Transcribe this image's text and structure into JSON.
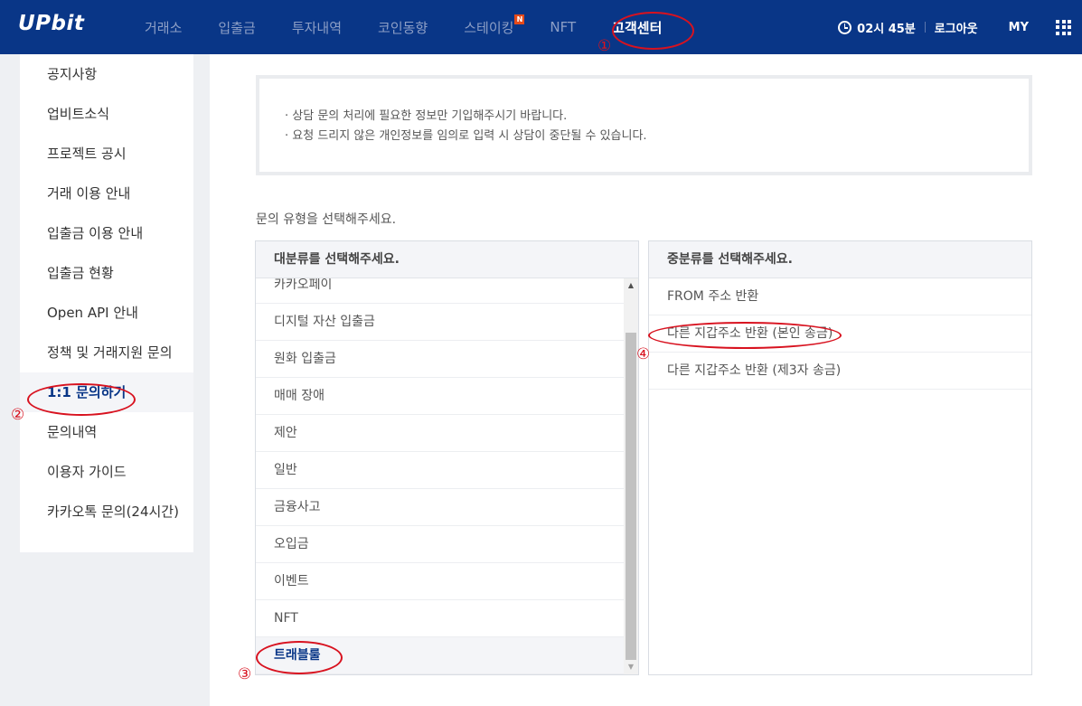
{
  "header": {
    "logo": "UPbit",
    "nav": [
      {
        "label": "거래소",
        "active": false
      },
      {
        "label": "입출금",
        "active": false
      },
      {
        "label": "투자내역",
        "active": false
      },
      {
        "label": "코인동향",
        "active": false
      },
      {
        "label": "스테이킹",
        "active": false,
        "badge": "N"
      },
      {
        "label": "NFT",
        "active": false
      },
      {
        "label": "고객센터",
        "active": true
      }
    ],
    "time": "02시 45분",
    "logout": "로그아웃",
    "my": "MY"
  },
  "sidebar": {
    "items": [
      {
        "label": "공지사항",
        "active": false
      },
      {
        "label": "업비트소식",
        "active": false
      },
      {
        "label": "프로젝트 공시",
        "active": false
      },
      {
        "label": "거래 이용 안내",
        "active": false
      },
      {
        "label": "입출금 이용 안내",
        "active": false
      },
      {
        "label": "입출금 현황",
        "active": false
      },
      {
        "label": "Open API 안내",
        "active": false
      },
      {
        "label": "정책 및 거래지원 문의",
        "active": false
      },
      {
        "label": "1:1 문의하기",
        "active": true
      },
      {
        "label": "문의내역",
        "active": false
      },
      {
        "label": "이용자 가이드",
        "active": false
      },
      {
        "label": "카카오톡 문의(24시간)",
        "active": false
      }
    ]
  },
  "notice": {
    "lines": [
      "· 상담 문의 처리에 필요한 정보만 기입해주시기 바랍니다.",
      "· 요청 드리지 않은 개인정보를 임의로 입력 시 상담이 중단될 수 있습니다."
    ]
  },
  "prompt": "문의 유형을 선택해주세요.",
  "major": {
    "header": "대분류를 선택해주세요.",
    "items": [
      {
        "label": "카카오페이",
        "selected": false
      },
      {
        "label": "디지털 자산 입출금",
        "selected": false
      },
      {
        "label": "원화 입출금",
        "selected": false
      },
      {
        "label": "매매 장애",
        "selected": false
      },
      {
        "label": "제안",
        "selected": false
      },
      {
        "label": "일반",
        "selected": false
      },
      {
        "label": "금융사고",
        "selected": false
      },
      {
        "label": "오입금",
        "selected": false
      },
      {
        "label": "이벤트",
        "selected": false
      },
      {
        "label": "NFT",
        "selected": false
      },
      {
        "label": "트래블룰",
        "selected": true
      }
    ]
  },
  "minor": {
    "header": "중분류를 선택해주세요.",
    "items": [
      {
        "label": "FROM 주소 반환"
      },
      {
        "label": "다른 지갑주소 반환 (본인 송금)"
      },
      {
        "label": "다른 지갑주소 반환 (제3자 송금)"
      }
    ]
  },
  "annotations": [
    "①",
    "②",
    "③",
    "④"
  ],
  "colors": {
    "header_bg": "#093687",
    "accent": "#093687",
    "annotation": "#d8121f",
    "badge": "#e64a19"
  },
  "icons": [
    "clock-icon",
    "grid-menu-icon",
    "scroll-up-arrow-icon",
    "scroll-down-arrow-icon"
  ]
}
